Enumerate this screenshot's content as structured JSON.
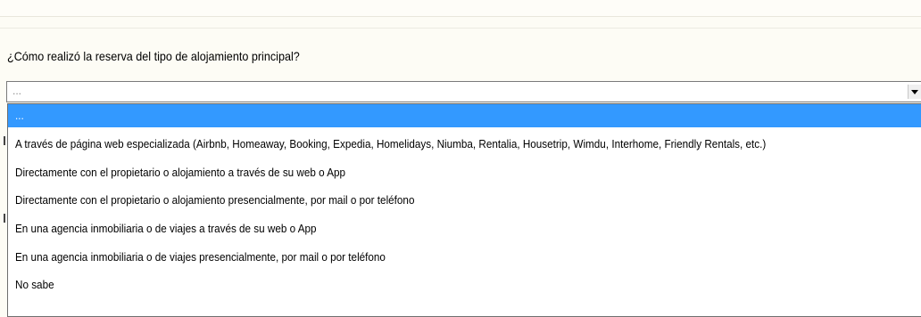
{
  "question": "¿Cómo realizó la reserva del tipo de alojamiento principal?",
  "select": {
    "value": "...",
    "options": [
      "...",
      "A través de página web especializada (Airbnb, Homeaway, Booking, Expedia, Homelidays, Niumba, Rentalia, Housetrip, Wimdu, Interhome, Friendly Rentals, etc.)",
      "Directamente con el propietario o alojamiento a través de su web o App",
      "Directamente con el propietario o alojamiento presencialmente, por mail o por teléfono",
      "En una agencia inmobiliaria o de viajes a través de su web o App",
      "En una agencia inmobiliaria o de viajes presencialmente, por mail o por teléfono",
      "No sabe"
    ],
    "highlighted_index": 0
  },
  "colors": {
    "highlight": "#3399ff",
    "background": "#fdfcf5"
  }
}
